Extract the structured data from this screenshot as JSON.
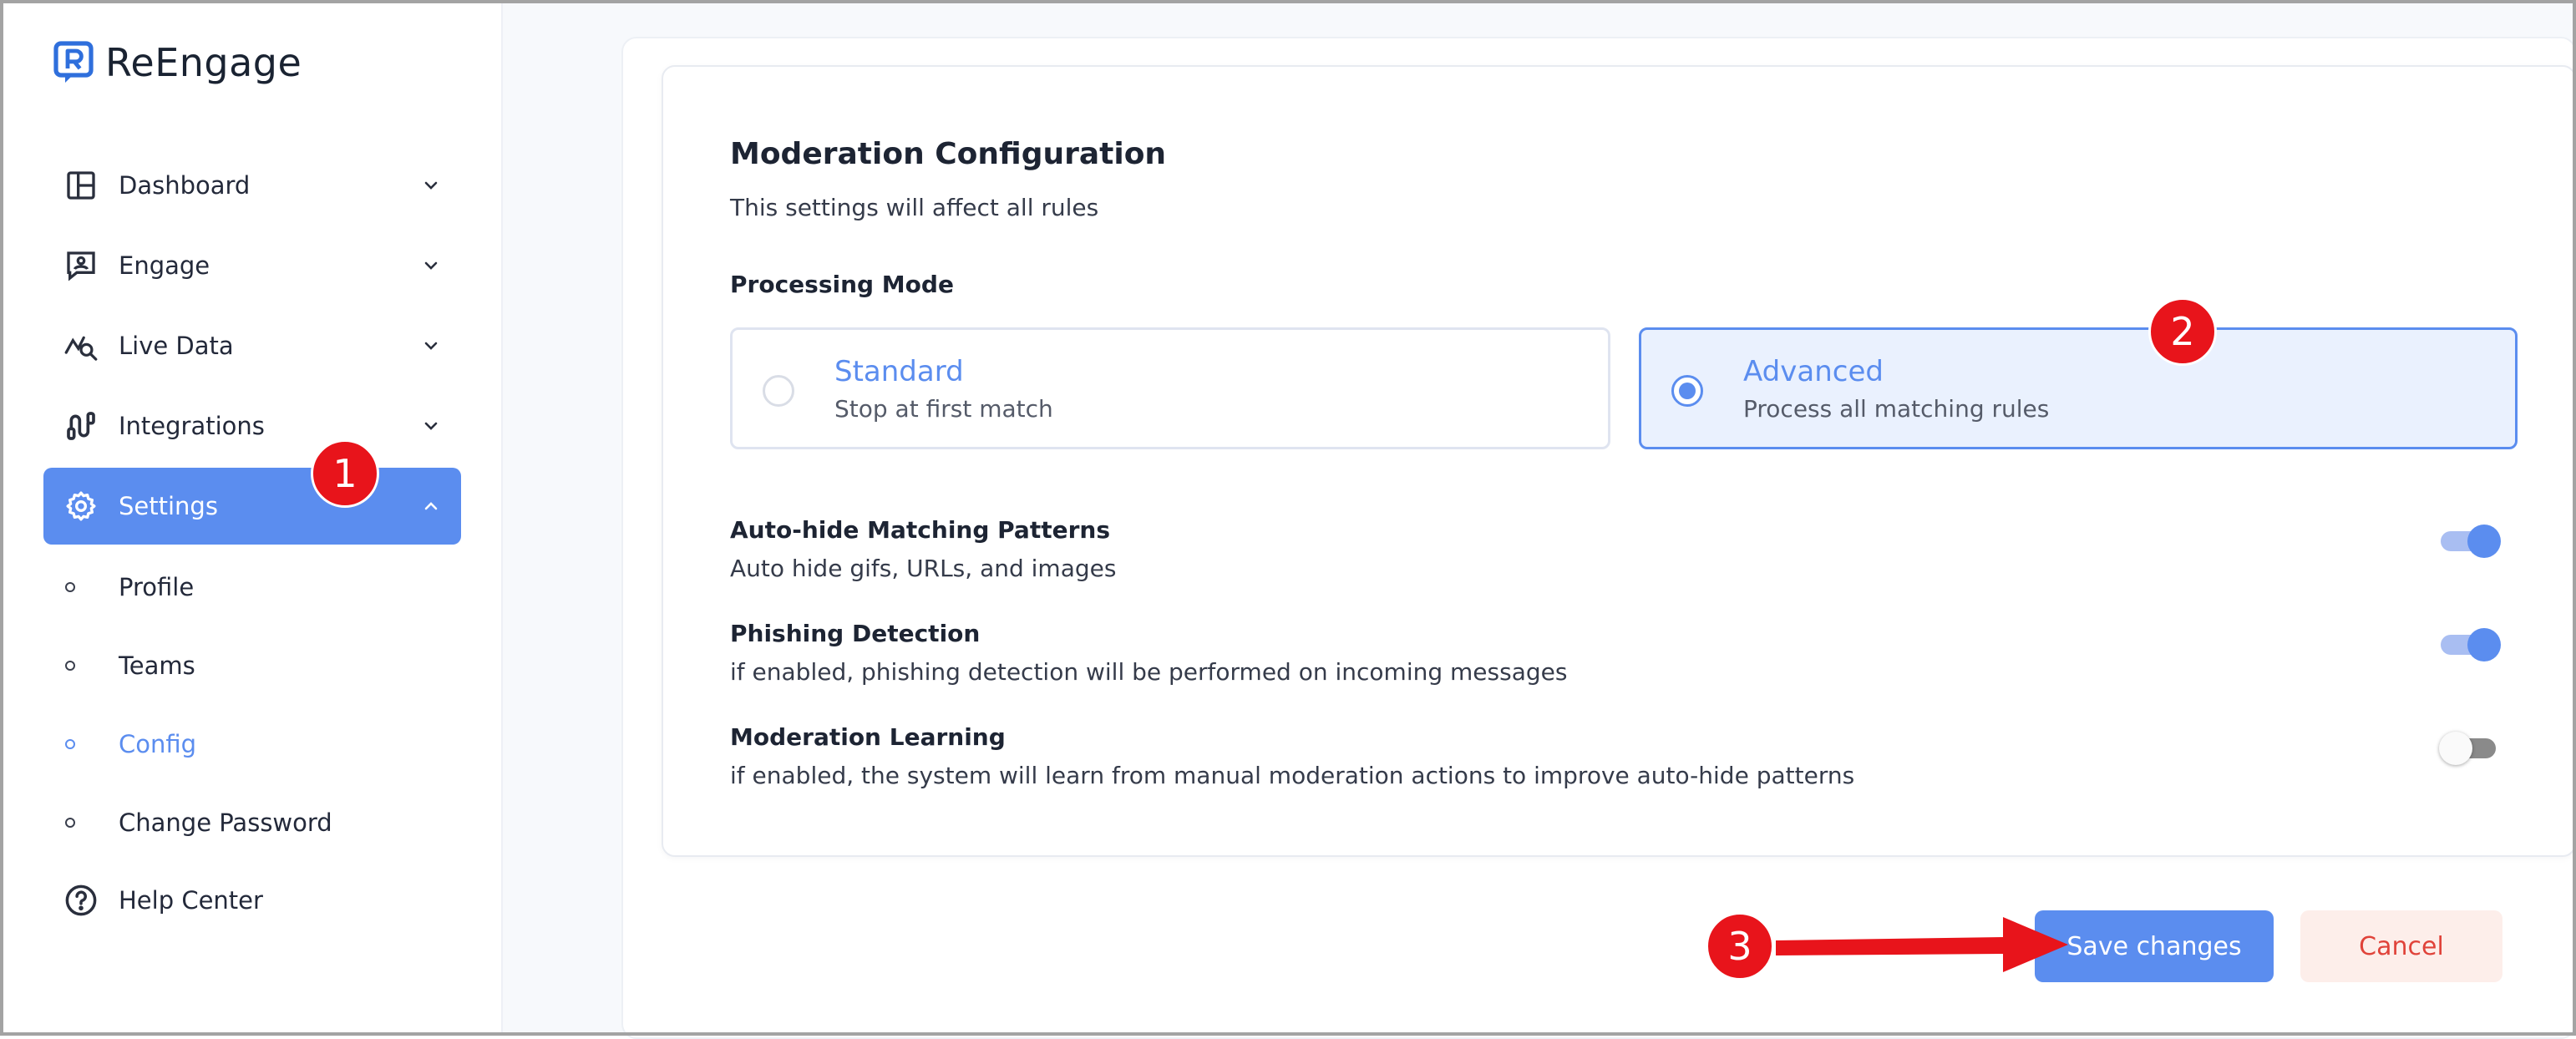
{
  "brand": {
    "name": "ReEngage"
  },
  "sidebar": {
    "items": [
      {
        "label": "Dashboard",
        "icon": "dashboard-icon"
      },
      {
        "label": "Engage",
        "icon": "engage-icon"
      },
      {
        "label": "Live Data",
        "icon": "live-data-icon"
      },
      {
        "label": "Integrations",
        "icon": "integrations-icon"
      },
      {
        "label": "Settings",
        "icon": "gear-icon",
        "active": true
      }
    ],
    "sub_items": [
      "Profile",
      "Teams",
      "Config",
      "Change Password"
    ],
    "current_sub": "Config",
    "help": {
      "label": "Help Center",
      "icon": "help-icon"
    }
  },
  "config": {
    "title": "Moderation Configuration",
    "subtitle": "This settings will affect all rules",
    "processing_mode_label": "Processing Mode",
    "modes": [
      {
        "title": "Standard",
        "desc": "Stop at first match",
        "selected": false
      },
      {
        "title": "Advanced",
        "desc": "Process all matching rules",
        "selected": true
      }
    ],
    "options": [
      {
        "title": "Auto-hide Matching Patterns",
        "desc": "Auto hide gifs, URLs, and images",
        "enabled": true
      },
      {
        "title": "Phishing Detection",
        "desc": "if enabled, phishing detection will be performed on incoming messages",
        "enabled": true
      },
      {
        "title": "Moderation Learning",
        "desc": "if enabled, the system will learn from manual moderation actions to improve auto-hide patterns",
        "enabled": false
      }
    ]
  },
  "actions": {
    "save": "Save changes",
    "cancel": "Cancel"
  },
  "annotations": {
    "step1": "1",
    "step2": "2",
    "step3": "3"
  },
  "colors": {
    "accent": "#5b8def",
    "annotation": "#e8141b",
    "cancel_text": "#e0433a"
  }
}
